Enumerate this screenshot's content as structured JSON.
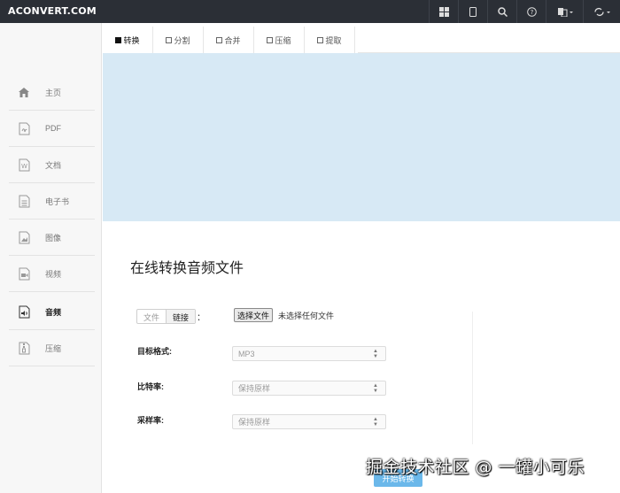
{
  "header": {
    "logo_text": "ACONVERT.COM",
    "icons": [
      "grid-icon",
      "mobile-icon",
      "search-icon",
      "help-icon",
      "language-icon",
      "refresh-icon"
    ]
  },
  "sidebar": {
    "items": [
      {
        "label": "主页",
        "icon": "home-icon"
      },
      {
        "label": "PDF",
        "icon": "pdf-icon"
      },
      {
        "label": "文档",
        "icon": "document-icon"
      },
      {
        "label": "电子书",
        "icon": "ebook-icon"
      },
      {
        "label": "图像",
        "icon": "image-icon"
      },
      {
        "label": "视频",
        "icon": "video-icon"
      },
      {
        "label": "音频",
        "icon": "audio-icon",
        "active": true
      },
      {
        "label": "压缩",
        "icon": "archive-icon"
      }
    ]
  },
  "tabs": [
    {
      "label": "转换",
      "active": true
    },
    {
      "label": "分割"
    },
    {
      "label": "合并"
    },
    {
      "label": "压缩"
    },
    {
      "label": "提取"
    }
  ],
  "main": {
    "heading": "在线转换音频文件",
    "source_toggle": {
      "file": "文件",
      "link": "链接",
      "colon": "："
    },
    "file_button": "选择文件",
    "file_status": "未选择任何文件",
    "target_format": {
      "label": "目标格式:",
      "value": "MP3"
    },
    "bitrate": {
      "label": "比特率:",
      "value": "保持原样"
    },
    "sample_rate": {
      "label": "采样率:",
      "value": "保持原样"
    },
    "start_button": "开始转换"
  },
  "watermark": "掘金技术社区 @ 一罐小可乐",
  "colors": {
    "topbar": "#2b2f36",
    "banner": "#d7e9f5",
    "accent": "#6bb8ea",
    "sidebar": "#f7f7f7"
  }
}
